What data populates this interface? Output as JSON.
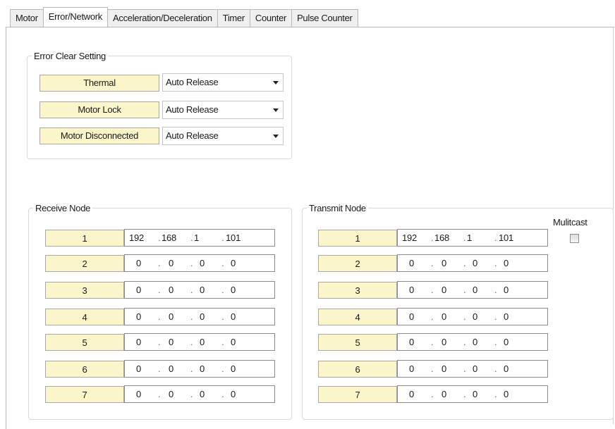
{
  "tabs": [
    {
      "label": "Motor"
    },
    {
      "label": "Error/Network",
      "active": true
    },
    {
      "label": "Acceleration/Deceleration"
    },
    {
      "label": "Timer"
    },
    {
      "label": "Counter"
    },
    {
      "label": "Pulse Counter"
    }
  ],
  "error_clear": {
    "title": "Error Clear Setting",
    "rows": [
      {
        "label": "Thermal",
        "value": "Auto Release"
      },
      {
        "label": "Motor Lock",
        "value": "Auto Release"
      },
      {
        "label": "Motor Disconnected",
        "value": "Auto Release"
      }
    ]
  },
  "receive_node": {
    "title": "Receive Node",
    "nodes": [
      {
        "label": "1",
        "ip": [
          "192",
          "168",
          "1",
          "101"
        ]
      },
      {
        "label": "2",
        "ip": [
          "0",
          "0",
          "0",
          "0"
        ]
      },
      {
        "label": "3",
        "ip": [
          "0",
          "0",
          "0",
          "0"
        ]
      },
      {
        "label": "4",
        "ip": [
          "0",
          "0",
          "0",
          "0"
        ]
      },
      {
        "label": "5",
        "ip": [
          "0",
          "0",
          "0",
          "0"
        ]
      },
      {
        "label": "6",
        "ip": [
          "0",
          "0",
          "0",
          "0"
        ]
      },
      {
        "label": "7",
        "ip": [
          "0",
          "0",
          "0",
          "0"
        ]
      }
    ]
  },
  "transmit_node": {
    "title": "Transmit Node",
    "multicast_label": "Mulitcast",
    "multicast_checked": false,
    "nodes": [
      {
        "label": "1",
        "ip": [
          "192",
          "168",
          "1",
          "101"
        ]
      },
      {
        "label": "2",
        "ip": [
          "0",
          "0",
          "0",
          "0"
        ]
      },
      {
        "label": "3",
        "ip": [
          "0",
          "0",
          "0",
          "0"
        ]
      },
      {
        "label": "4",
        "ip": [
          "0",
          "0",
          "0",
          "0"
        ]
      },
      {
        "label": "5",
        "ip": [
          "0",
          "0",
          "0",
          "0"
        ]
      },
      {
        "label": "6",
        "ip": [
          "0",
          "0",
          "0",
          "0"
        ]
      },
      {
        "label": "7",
        "ip": [
          "0",
          "0",
          "0",
          "0"
        ]
      }
    ]
  },
  "ip_separator": "."
}
